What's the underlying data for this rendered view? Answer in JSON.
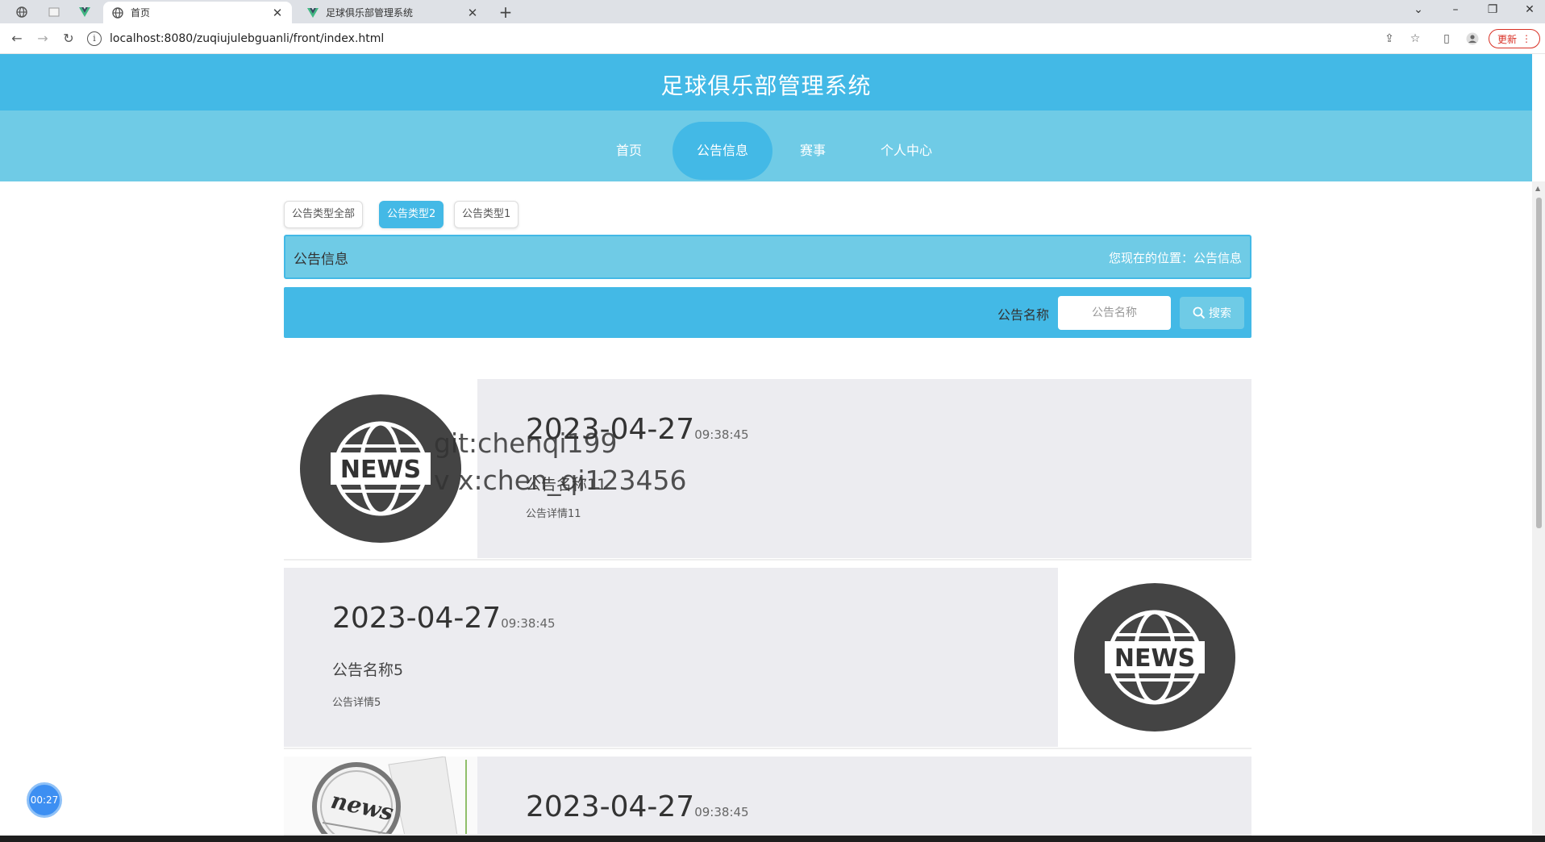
{
  "browser": {
    "tabs": [
      {
        "title": "首页",
        "active": true
      },
      {
        "title": "足球俱乐部管理系统",
        "active": false
      }
    ],
    "url": "localhost:8080/zuqiujulebguanli/front/index.html",
    "update_label": "更新"
  },
  "site": {
    "title": "足球俱乐部管理系统",
    "nav": [
      "首页",
      "公告信息",
      "赛事",
      "个人中心"
    ],
    "active_nav": "公告信息"
  },
  "filters": {
    "types": [
      "公告类型全部",
      "公告类型2",
      "公告类型1"
    ],
    "active": "公告类型2"
  },
  "breadcrumb": {
    "title": "公告信息",
    "location": "您现在的位置：公告信息"
  },
  "search": {
    "label": "公告名称",
    "placeholder": "公告名称",
    "button": "搜索"
  },
  "notices": [
    {
      "date": "2023-04-27",
      "time": "09:38:45",
      "name": "公告名称11",
      "detail": "公告详情11",
      "image": "news-globe-icon"
    },
    {
      "date": "2023-04-27",
      "time": "09:38:45",
      "name": "公告名称5",
      "detail": "公告详情5",
      "image": "news-globe-icon"
    },
    {
      "date": "2023-04-27",
      "time": "09:38:45",
      "name": "",
      "detail": "",
      "image": "newspaper-magnifier-icon"
    }
  ],
  "watermark": {
    "line1": "git:chenqi199",
    "line2": "v x:chen_qi123456"
  },
  "timer": "00:27",
  "colors": {
    "primary": "#43b9e6",
    "secondary": "#6fcbe6"
  }
}
